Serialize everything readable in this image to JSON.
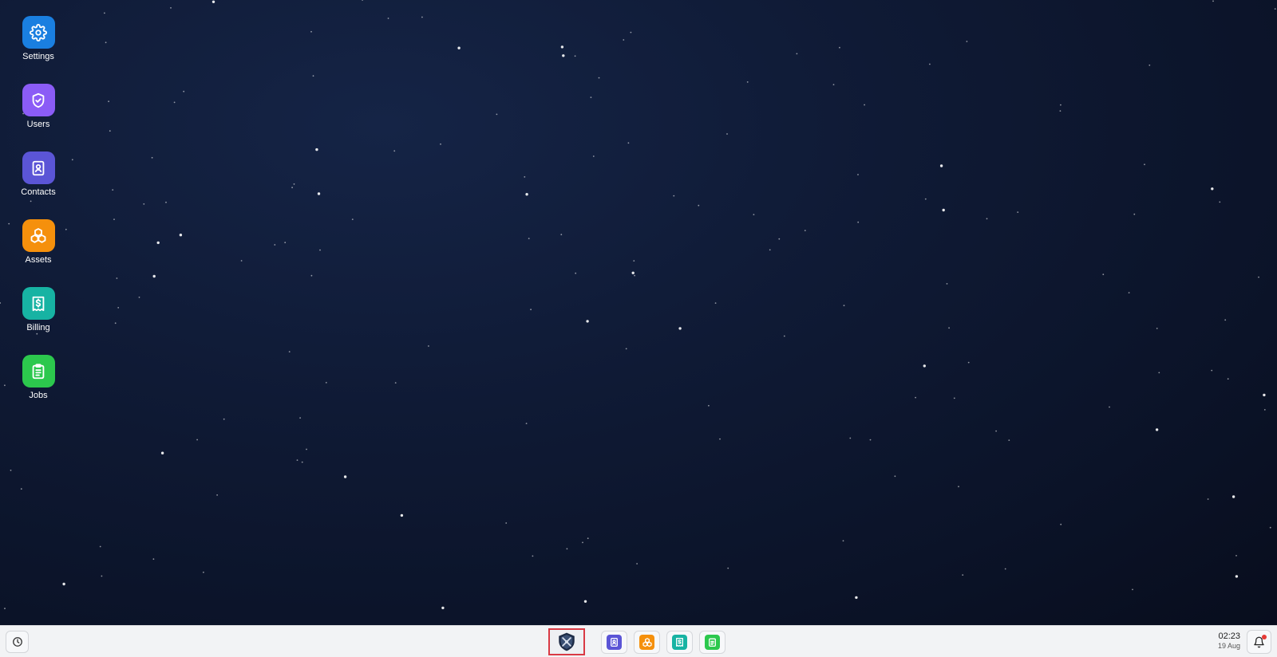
{
  "desktop": {
    "icons": [
      {
        "label": "Settings",
        "icon": "gear-icon",
        "color": "#1a7fe0"
      },
      {
        "label": "Users",
        "icon": "shield-check-icon",
        "color": "#8b5cf6"
      },
      {
        "label": "Contacts",
        "icon": "contact-book-icon",
        "color": "#5b55d6"
      },
      {
        "label": "Assets",
        "icon": "cubes-icon",
        "color": "#f5900c"
      },
      {
        "label": "Billing",
        "icon": "dollar-receipt-icon",
        "color": "#17b3a3"
      },
      {
        "label": "Jobs",
        "icon": "clipboard-icon",
        "color": "#2cc84d"
      }
    ]
  },
  "taskbar": {
    "history_icon": "clock-history-icon",
    "start_icon": "shield-logo-icon",
    "pinned": [
      {
        "icon": "contact-book-icon",
        "color": "#5b55d6"
      },
      {
        "icon": "cubes-icon",
        "color": "#f5900c"
      },
      {
        "icon": "dollar-receipt-icon",
        "color": "#17b3a3"
      },
      {
        "icon": "clipboard-icon",
        "color": "#2cc84d"
      }
    ],
    "clock": {
      "time": "02:23",
      "date": "19 Aug"
    },
    "notification_icon": "bell-icon"
  }
}
